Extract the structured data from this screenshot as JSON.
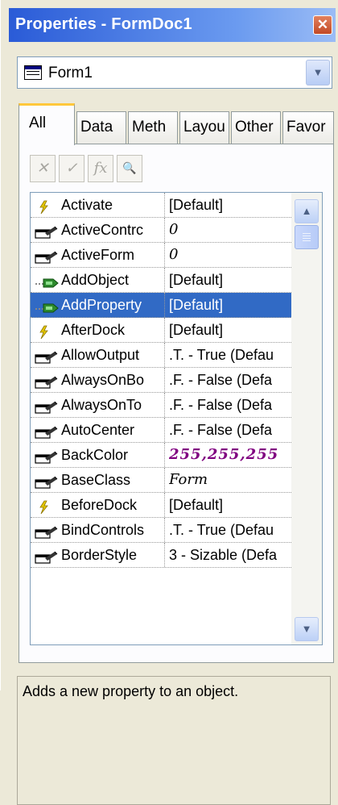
{
  "window": {
    "title": "Properties - FormDoc1",
    "close_glyph": "✕"
  },
  "object_selector": {
    "selected": "Form1",
    "icon": "form-icon"
  },
  "tabs": [
    {
      "label": "All",
      "active": true
    },
    {
      "label": "Data"
    },
    {
      "label": "Meth"
    },
    {
      "label": "Layou"
    },
    {
      "label": "Other"
    },
    {
      "label": "Favor"
    }
  ],
  "toolbar": {
    "buttons": [
      {
        "name": "cancel-button",
        "glyph": "✕"
      },
      {
        "name": "accept-button",
        "glyph": "✓"
      },
      {
        "name": "function-button",
        "glyph": "fx"
      },
      {
        "name": "zoom-button",
        "glyph": "🔍"
      }
    ]
  },
  "properties": [
    {
      "name": "Activate",
      "value": "[Default]",
      "icon": "event-icon"
    },
    {
      "name": "ActiveContrc",
      "value": "0",
      "icon": "property-icon",
      "style": "italic"
    },
    {
      "name": "ActiveForm",
      "value": "0",
      "icon": "property-icon",
      "style": "italic"
    },
    {
      "name": "AddObject",
      "value": "[Default]",
      "icon": "method-icon"
    },
    {
      "name": "AddProperty",
      "value": "[Default]",
      "icon": "method-icon",
      "selected": true
    },
    {
      "name": "AfterDock",
      "value": "[Default]",
      "icon": "event-icon"
    },
    {
      "name": "AllowOutput",
      "value": ".T. - True (Defau",
      "icon": "property-icon"
    },
    {
      "name": "AlwaysOnBo",
      "value": ".F. - False (Defa",
      "icon": "property-icon"
    },
    {
      "name": "AlwaysOnTo",
      "value": ".F. - False (Defa",
      "icon": "property-icon"
    },
    {
      "name": "AutoCenter",
      "value": ".F. - False (Defa",
      "icon": "property-icon"
    },
    {
      "name": "BackColor",
      "value": "255,255,255",
      "icon": "property-icon",
      "style": "color"
    },
    {
      "name": "BaseClass",
      "value": "Form",
      "icon": "property-icon",
      "style": "italic"
    },
    {
      "name": "BeforeDock",
      "value": "[Default]",
      "icon": "event-icon"
    },
    {
      "name": "BindControls",
      "value": ".T. - True (Defau",
      "icon": "property-icon"
    },
    {
      "name": "BorderStyle",
      "value": "3 - Sizable (Defa",
      "icon": "property-icon"
    }
  ],
  "description": "Adds a new property to an object.",
  "colors": {
    "title_bar": "#2a5bd7",
    "selection": "#316ac5",
    "color_value": "#800080"
  }
}
